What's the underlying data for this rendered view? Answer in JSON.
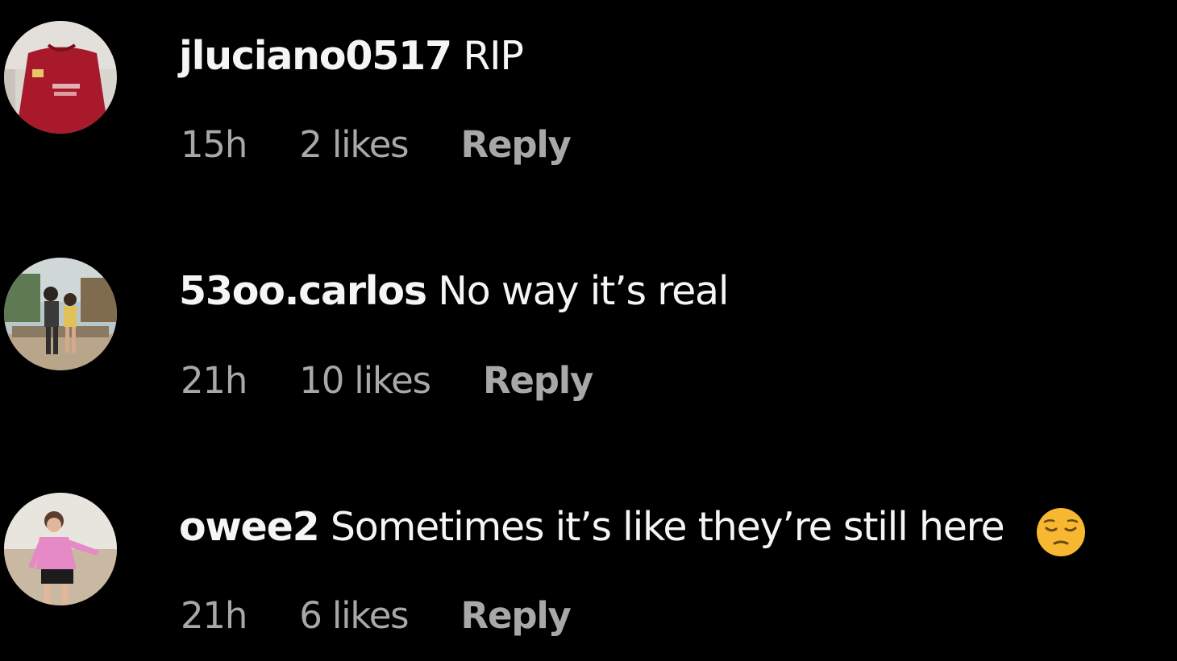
{
  "comments": [
    {
      "username": "jluciano0517",
      "text": "RIP",
      "time": "15h",
      "likes": "2 likes",
      "reply_label": "Reply",
      "avatar_icon": "avatar-red-jersey"
    },
    {
      "username": "53oo.carlos",
      "text": "No way it’s real",
      "time": "21h",
      "likes": "10 likes",
      "reply_label": "Reply",
      "avatar_icon": "avatar-couple-bench"
    },
    {
      "username": "owee2",
      "text": "Sometimes it’s like they’re still here",
      "time": "21h",
      "likes": "6 likes",
      "reply_label": "Reply",
      "avatar_icon": "avatar-pink-jacket",
      "emoji": "pensive-face-emoji"
    }
  ],
  "colors": {
    "background": "#000000",
    "primary_text": "#f5f5f5",
    "secondary_text": "#a8a8a8",
    "emoji_yellow": "#f7b731"
  }
}
